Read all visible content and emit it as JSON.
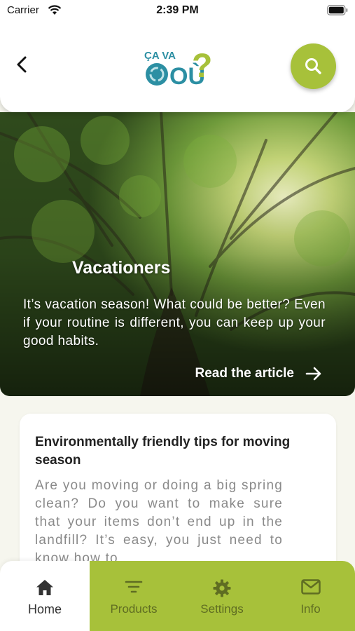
{
  "status_bar": {
    "carrier": "Carrier",
    "time": "2:39 PM"
  },
  "header": {
    "logo_text_top": "ÇA VA",
    "logo_text_bottom": "OÙ",
    "logo_mark": "?",
    "colors": {
      "logo_teal": "#2c8fa3",
      "logo_green": "#a7c13a"
    }
  },
  "hero": {
    "title": "Vacationers",
    "text": "It’s vacation season! What could be better? Even if your routine is different, you can keep up your good habits.",
    "link_label": "Read the article"
  },
  "article_card": {
    "title": "Environmentally friendly tips for moving season",
    "text": "Are you moving or doing a big spring clean? Do you want to make sure that your items don’t end up in the landfill? It’s easy, you just need to know how to"
  },
  "bottom_nav": {
    "items": [
      {
        "label": "Home",
        "icon": "home-icon",
        "active": true
      },
      {
        "label": "Products",
        "icon": "filter-icon",
        "active": false
      },
      {
        "label": "Settings",
        "icon": "gear-icon",
        "active": false
      },
      {
        "label": "Info",
        "icon": "mail-icon",
        "active": false
      }
    ]
  },
  "colors": {
    "accent": "#a7c13a",
    "background": "#f6f6ee",
    "nav_inactive": "#5f6d22"
  }
}
